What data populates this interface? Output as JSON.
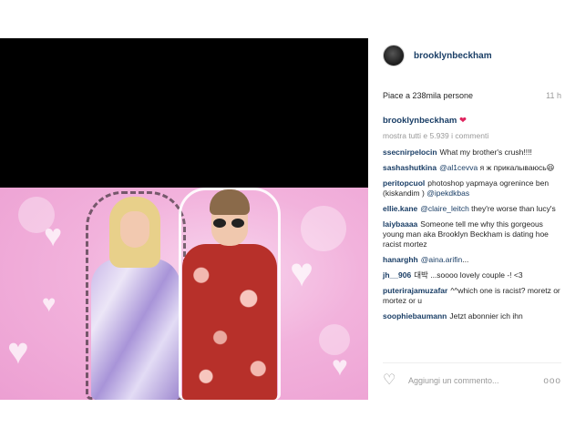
{
  "post": {
    "username": "brooklynbeckham",
    "likes_text": "Piace a 238mila persone",
    "time": "11 h",
    "owner_caption_user": "brooklynbeckham",
    "owner_caption_emoji": "❤",
    "show_all": "mostra tutti e 5.939 i commenti"
  },
  "comments": [
    {
      "user": "ssecnirpelocin",
      "text": "What my brother's crush!!!!",
      "mention": ""
    },
    {
      "user": "sashashutkina",
      "mention": "@al1cevva",
      "text": "я ж прикалываюсь😆"
    },
    {
      "user": "peritopcuol",
      "text": "photoshop yapmaya ogrenince ben (kiskandim )",
      "mention": "@ipekdkbas"
    },
    {
      "user": "ellie.kane",
      "mention": "@claire_leitch",
      "text": "they're worse than lucy's"
    },
    {
      "user": "laiybaaaa",
      "text": "Someone tell me why this gorgeous young man aka Brooklyn Beckham is dating hoe racist mortez",
      "mention": ""
    },
    {
      "user": "hanarghh",
      "mention": "@aina.arifin",
      "text": "..."
    },
    {
      "user": "jh__906",
      "text": "대박 ...soooo lovely couple -! <3",
      "mention": ""
    },
    {
      "user": "puterirajamuzafar",
      "text": "^^which one is racist? moretz or mortez or u",
      "mention": ""
    },
    {
      "user": "soophiebaumann",
      "text": "Jetzt abonnier ich ihn",
      "mention": ""
    }
  ],
  "composer": {
    "placeholder": "Aggiungi un commento...",
    "more": "ooo"
  },
  "icons": {
    "heart": "heart-outline-icon",
    "more": "more-options-icon",
    "avatar": "avatar"
  },
  "colors": {
    "username": "#1a3e66",
    "muted": "#999999",
    "photo_bg": "#f2b2dc"
  }
}
